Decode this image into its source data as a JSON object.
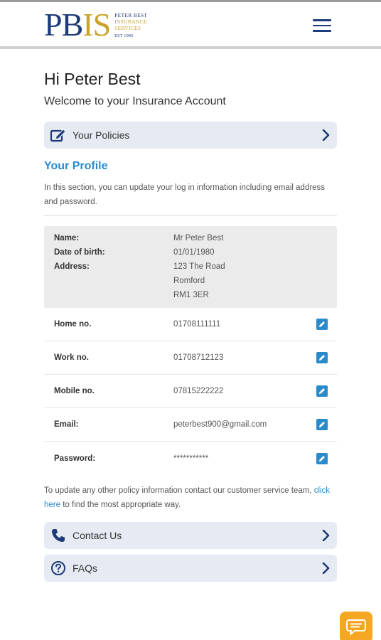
{
  "header": {
    "logo": {
      "letters_pb": "PB",
      "letters_is": "IS",
      "line1": "PETER BEST",
      "line2a": "INSURANCE",
      "line2b": "SERVICES",
      "line3": "EST 1985"
    },
    "menu_icon": "hamburger-icon"
  },
  "greeting": "Hi Peter Best",
  "welcome": "Welcome to your Insurance Account",
  "nav": {
    "policies_label": "Your Policies",
    "contact_label": "Contact Us",
    "faqs_label": "FAQs"
  },
  "profile": {
    "title": "Your Profile",
    "description": "In this section, you can update your log in information including email address and password.",
    "info": {
      "name_key": "Name:",
      "name_val": "Mr Peter Best",
      "dob_key": "Date of birth:",
      "dob_val": "01/01/1980",
      "address_key": "Address:",
      "address_line1": "123 The Road",
      "address_line2": "Romford",
      "address_line3": "RM1 3ER"
    },
    "fields": {
      "home_key": "Home no.",
      "home_val": "01708111111",
      "work_key": "Work no.",
      "work_val": "01708712123",
      "mobile_key": "Mobile no.",
      "mobile_val": "07815222222",
      "email_key": "Email:",
      "email_val": "peterbest900@gmail.com",
      "password_key": "Password:",
      "password_val": "***********"
    }
  },
  "footer_note": {
    "before": "To update any other policy information contact our customer service team, ",
    "link": "click here",
    "after": " to find the most appropriate way."
  },
  "colors": {
    "brand_navy": "#1d3a7a",
    "brand_gold": "#c9a227",
    "accent_blue": "#2a8bcb",
    "card_bg": "#e6ebf3",
    "chat_orange": "#f5a623"
  }
}
